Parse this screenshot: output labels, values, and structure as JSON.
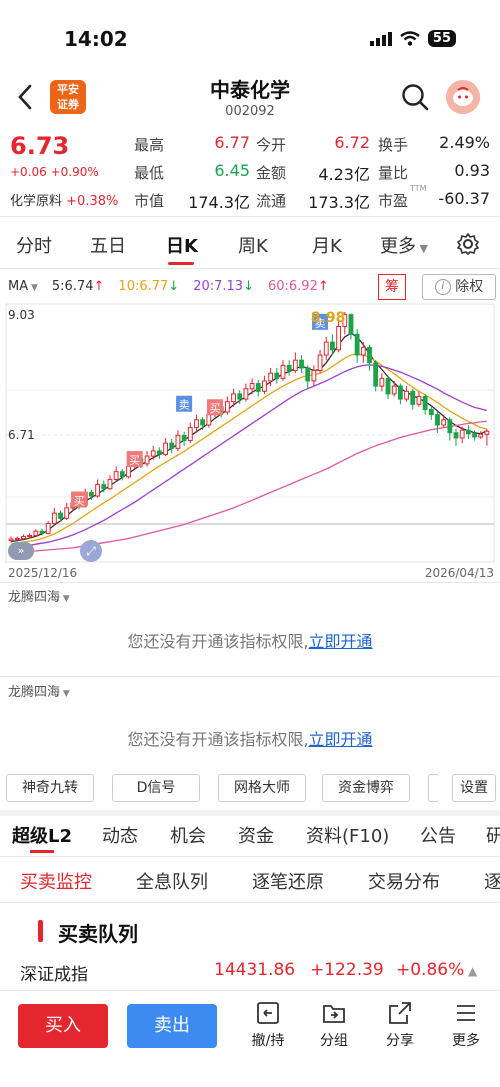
{
  "status_bar": {
    "time": "14:02",
    "battery": "55"
  },
  "header": {
    "stock_name": "中泰化学",
    "stock_code": "002092",
    "broker_logo_line1": "平安",
    "broker_logo_line2": "证券"
  },
  "quote": {
    "price": "6.73",
    "change": "+0.06 +0.90%",
    "sector": "化学原料",
    "sector_change": "+0.38%",
    "fields": [
      {
        "label": "最高",
        "value": "6.77",
        "color": "#e4262e"
      },
      {
        "label": "今开",
        "value": "6.72",
        "color": "#e4262e"
      },
      {
        "label": "换手",
        "value": "2.49%",
        "color": "#222222"
      },
      {
        "label": "最低",
        "value": "6.45",
        "color": "#1aa34a"
      },
      {
        "label": "金额",
        "value": "4.23亿",
        "color": "#222222"
      },
      {
        "label": "量比",
        "value": "0.93",
        "color": "#222222"
      },
      {
        "label": "市值",
        "value": "174.3亿",
        "color": "#222222"
      },
      {
        "label": "流通",
        "value": "173.3亿",
        "color": "#222222"
      },
      {
        "label": "市盈",
        "value": "-60.37",
        "color": "#222222",
        "sup": "TTM"
      }
    ]
  },
  "period_tabs": [
    "分时",
    "五日",
    "日K",
    "周K",
    "月K",
    "更多"
  ],
  "active_period": "日K",
  "ma_legend": {
    "label": "MA",
    "items": [
      {
        "text": "5:6.74",
        "arrow": "↑",
        "color": "#333333",
        "arrow_color": "#e4262e"
      },
      {
        "text": "10:6.77",
        "arrow": "↓",
        "color": "#e8a317",
        "arrow_color": "#1aa34a"
      },
      {
        "text": "20:7.13",
        "arrow": "↓",
        "color": "#9b3fd1",
        "arrow_color": "#1aa34a"
      },
      {
        "text": "60:6.92",
        "arrow": "↑",
        "color": "#e0579a",
        "arrow_color": "#e4262e"
      }
    ],
    "chip_label": "筹",
    "exright_label": "除权"
  },
  "chart_data": {
    "type": "candlestick",
    "y_high_label": "9.03",
    "y_mid_label": "6.71",
    "ylim": [
      4.4,
      9.03
    ],
    "max_marker": "8.98",
    "date_start": "2025/12/16",
    "date_end": "2026/04/13",
    "candles": [
      [
        4.62,
        4.65,
        4.58,
        4.7
      ],
      [
        4.64,
        4.66,
        4.6,
        4.7
      ],
      [
        4.66,
        4.7,
        4.63,
        4.74
      ],
      [
        4.7,
        4.72,
        4.66,
        4.76
      ],
      [
        4.72,
        4.8,
        4.7,
        4.84
      ],
      [
        4.8,
        4.76,
        4.72,
        4.85
      ],
      [
        4.76,
        4.95,
        4.74,
        5.0
      ],
      [
        4.95,
        5.15,
        4.92,
        5.25
      ],
      [
        5.15,
        5.05,
        5.0,
        5.2
      ],
      [
        5.05,
        5.25,
        5.02,
        5.35
      ],
      [
        5.25,
        5.35,
        5.2,
        5.45
      ],
      [
        5.35,
        5.3,
        5.22,
        5.42
      ],
      [
        5.3,
        5.55,
        5.28,
        5.62
      ],
      [
        5.55,
        5.48,
        5.4,
        5.6
      ],
      [
        5.48,
        5.7,
        5.45,
        5.8
      ],
      [
        5.7,
        5.62,
        5.55,
        5.78
      ],
      [
        5.62,
        5.8,
        5.6,
        5.88
      ],
      [
        5.8,
        5.95,
        5.75,
        6.05
      ],
      [
        5.95,
        5.85,
        5.78,
        6.0
      ],
      [
        5.85,
        6.05,
        5.82,
        6.15
      ],
      [
        6.05,
        6.2,
        6.0,
        6.3
      ],
      [
        6.2,
        6.1,
        6.02,
        6.28
      ],
      [
        6.1,
        6.25,
        6.05,
        6.35
      ],
      [
        6.25,
        6.35,
        6.18,
        6.45
      ],
      [
        6.35,
        6.28,
        6.2,
        6.42
      ],
      [
        6.28,
        6.5,
        6.25,
        6.6
      ],
      [
        6.5,
        6.4,
        6.3,
        6.58
      ],
      [
        6.4,
        6.65,
        6.35,
        6.75
      ],
      [
        6.65,
        6.55,
        6.45,
        6.72
      ],
      [
        6.55,
        6.8,
        6.5,
        6.9
      ],
      [
        6.8,
        6.95,
        6.7,
        7.05
      ],
      [
        6.95,
        6.85,
        6.75,
        7.0
      ],
      [
        6.85,
        7.05,
        6.8,
        7.15
      ],
      [
        7.05,
        7.2,
        7.0,
        7.3
      ],
      [
        7.2,
        7.1,
        7.0,
        7.28
      ],
      [
        7.1,
        7.3,
        7.05,
        7.4
      ],
      [
        7.3,
        7.45,
        7.2,
        7.55
      ],
      [
        7.45,
        7.35,
        7.25,
        7.52
      ],
      [
        7.35,
        7.55,
        7.3,
        7.65
      ],
      [
        7.55,
        7.65,
        7.45,
        7.75
      ],
      [
        7.65,
        7.5,
        7.4,
        7.72
      ],
      [
        7.5,
        7.7,
        7.45,
        7.8
      ],
      [
        7.7,
        7.85,
        7.6,
        7.95
      ],
      [
        7.85,
        7.75,
        7.65,
        7.95
      ],
      [
        7.75,
        8.0,
        7.7,
        8.1
      ],
      [
        8.0,
        7.9,
        7.8,
        8.1
      ],
      [
        7.9,
        8.1,
        7.85,
        8.25
      ],
      [
        8.1,
        7.95,
        7.85,
        8.2
      ],
      [
        7.95,
        7.7,
        7.55,
        8.0
      ],
      [
        7.7,
        7.9,
        7.6,
        8.0
      ],
      [
        7.9,
        8.2,
        7.85,
        8.3
      ],
      [
        8.2,
        8.45,
        8.1,
        8.55
      ],
      [
        8.45,
        8.3,
        8.2,
        8.6
      ],
      [
        8.3,
        8.75,
        8.25,
        8.9
      ],
      [
        8.75,
        8.98,
        8.6,
        9.03
      ],
      [
        8.98,
        8.6,
        8.5,
        9.0
      ],
      [
        8.6,
        8.2,
        8.05,
        8.7
      ],
      [
        8.2,
        8.35,
        8.05,
        8.45
      ],
      [
        8.35,
        8.05,
        7.9,
        8.4
      ],
      [
        8.05,
        7.6,
        7.5,
        8.1
      ],
      [
        7.6,
        7.75,
        7.5,
        7.85
      ],
      [
        7.75,
        7.45,
        7.35,
        7.8
      ],
      [
        7.45,
        7.6,
        7.4,
        7.7
      ],
      [
        7.6,
        7.35,
        7.25,
        7.65
      ],
      [
        7.35,
        7.5,
        7.3,
        7.6
      ],
      [
        7.5,
        7.25,
        7.15,
        7.55
      ],
      [
        7.25,
        7.4,
        7.2,
        7.5
      ],
      [
        7.4,
        7.15,
        7.05,
        7.45
      ],
      [
        7.15,
        7.05,
        6.95,
        7.2
      ],
      [
        7.05,
        6.85,
        6.7,
        7.1
      ],
      [
        6.85,
        6.95,
        6.8,
        7.05
      ],
      [
        6.95,
        6.7,
        6.55,
        7.0
      ],
      [
        6.7,
        6.6,
        6.45,
        6.78
      ],
      [
        6.6,
        6.75,
        6.5,
        6.82
      ],
      [
        6.75,
        6.68,
        6.58,
        6.85
      ],
      [
        6.68,
        6.62,
        6.55,
        6.75
      ],
      [
        6.62,
        6.67,
        6.58,
        6.73
      ],
      [
        6.67,
        6.73,
        6.45,
        6.77
      ]
    ],
    "ma_lines": [
      {
        "name": "MA5",
        "color": "#333333",
        "values": [
          4.6,
          4.62,
          4.64,
          4.67,
          4.7,
          4.75,
          4.82,
          4.92,
          5.0,
          5.1,
          5.2,
          5.28,
          5.38,
          5.45,
          5.52,
          5.6,
          5.68,
          5.76,
          5.84,
          5.92,
          6.0,
          6.08,
          6.15,
          6.22,
          6.28,
          6.34,
          6.4,
          6.48,
          6.56,
          6.64,
          6.72,
          6.8,
          6.88,
          6.98,
          7.06,
          7.14,
          7.24,
          7.32,
          7.4,
          7.48,
          7.55,
          7.6,
          7.68,
          7.76,
          7.84,
          7.88,
          7.94,
          7.98,
          7.95,
          7.9,
          7.92,
          8.05,
          8.22,
          8.4,
          8.55,
          8.62,
          8.55,
          8.4,
          8.22,
          8.05,
          7.92,
          7.78,
          7.66,
          7.55,
          7.48,
          7.42,
          7.36,
          7.3,
          7.22,
          7.12,
          7.02,
          6.92,
          6.84,
          6.78,
          6.74,
          6.7,
          6.68,
          6.74
        ]
      },
      {
        "name": "MA10",
        "color": "#e8a317",
        "values": [
          4.55,
          4.57,
          4.59,
          4.61,
          4.63,
          4.66,
          4.7,
          4.75,
          4.81,
          4.88,
          4.95,
          5.03,
          5.11,
          5.19,
          5.27,
          5.35,
          5.42,
          5.5,
          5.58,
          5.66,
          5.74,
          5.82,
          5.9,
          5.98,
          6.06,
          6.13,
          6.2,
          6.27,
          6.34,
          6.42,
          6.5,
          6.58,
          6.66,
          6.74,
          6.82,
          6.9,
          6.98,
          7.06,
          7.14,
          7.22,
          7.3,
          7.38,
          7.46,
          7.53,
          7.6,
          7.66,
          7.72,
          7.77,
          7.8,
          7.82,
          7.85,
          7.9,
          7.98,
          8.06,
          8.14,
          8.2,
          8.22,
          8.2,
          8.15,
          8.08,
          8.0,
          7.92,
          7.84,
          7.75,
          7.66,
          7.58,
          7.5,
          7.43,
          7.36,
          7.28,
          7.2,
          7.12,
          7.05,
          6.98,
          6.92,
          6.86,
          6.8,
          6.77
        ]
      },
      {
        "name": "MA20",
        "color": "#9b3fd1",
        "values": [
          4.5,
          4.51,
          4.52,
          4.53,
          4.55,
          4.57,
          4.59,
          4.62,
          4.65,
          4.69,
          4.73,
          4.78,
          4.83,
          4.89,
          4.95,
          5.01,
          5.08,
          5.15,
          5.22,
          5.29,
          5.36,
          5.44,
          5.52,
          5.6,
          5.68,
          5.76,
          5.84,
          5.92,
          6.0,
          6.08,
          6.16,
          6.24,
          6.32,
          6.4,
          6.48,
          6.56,
          6.64,
          6.72,
          6.8,
          6.88,
          6.96,
          7.04,
          7.12,
          7.2,
          7.28,
          7.36,
          7.43,
          7.5,
          7.55,
          7.6,
          7.65,
          7.7,
          7.76,
          7.82,
          7.88,
          7.93,
          7.97,
          8.0,
          8.01,
          8.0,
          7.98,
          7.95,
          7.91,
          7.87,
          7.82,
          7.77,
          7.72,
          7.66,
          7.6,
          7.54,
          7.47,
          7.41,
          7.35,
          7.29,
          7.24,
          7.19,
          7.16,
          7.13
        ]
      },
      {
        "name": "MA60",
        "color": "#e0579a",
        "values": [
          4.4,
          4.41,
          4.41,
          4.42,
          4.42,
          4.43,
          4.44,
          4.45,
          4.46,
          4.47,
          4.48,
          4.5,
          4.52,
          4.54,
          4.56,
          4.58,
          4.6,
          4.62,
          4.64,
          4.66,
          4.69,
          4.72,
          4.75,
          4.78,
          4.81,
          4.84,
          4.87,
          4.9,
          4.93,
          4.97,
          5.01,
          5.05,
          5.09,
          5.13,
          5.17,
          5.21,
          5.25,
          5.3,
          5.35,
          5.4,
          5.45,
          5.5,
          5.55,
          5.6,
          5.65,
          5.7,
          5.75,
          5.8,
          5.85,
          5.9,
          5.95,
          6.0,
          6.06,
          6.12,
          6.18,
          6.24,
          6.3,
          6.35,
          6.4,
          6.45,
          6.49,
          6.53,
          6.57,
          6.61,
          6.64,
          6.67,
          6.7,
          6.73,
          6.76,
          6.78,
          6.8,
          6.82,
          6.84,
          6.86,
          6.88,
          6.89,
          6.91,
          6.92
        ]
      }
    ],
    "signals": [
      {
        "label": "买",
        "index": 11,
        "kind": "buy"
      },
      {
        "label": "买",
        "index": 20,
        "kind": "buy"
      },
      {
        "label": "卖",
        "index": 28,
        "kind": "sell"
      },
      {
        "label": "买",
        "index": 33,
        "kind": "buy"
      },
      {
        "label": "卖",
        "index": 50,
        "kind": "sell"
      }
    ]
  },
  "indicator_panels": [
    {
      "title": "龙腾四海",
      "message": "您还没有开通该指标权限,",
      "link": "立即开通"
    },
    {
      "title": "龙腾四海",
      "message": "您还没有开通该指标权限,",
      "link": "立即开通"
    }
  ],
  "tools": [
    "神奇九转",
    "D信号",
    "网格大师",
    "资金博弈",
    "设置"
  ],
  "info_tabs": [
    "超级L2",
    "动态",
    "机会",
    "资金",
    "资料(F10)",
    "公告",
    "研"
  ],
  "sub_tabs": [
    "买卖监控",
    "全息队列",
    "逐笔还原",
    "交易分布",
    "逐"
  ],
  "queue_title": "买卖队列",
  "index_ticker": {
    "name": "深证成指",
    "value": "14431.86",
    "change": "+122.39",
    "pct": "+0.86%"
  },
  "bottom_bar": {
    "buy": "买入",
    "sell": "卖出",
    "items": [
      {
        "label": "撤/持",
        "icon": "withdraw-icon"
      },
      {
        "label": "分组",
        "icon": "folder-icon"
      },
      {
        "label": "分享",
        "icon": "share-icon"
      },
      {
        "label": "更多",
        "icon": "menu-icon"
      }
    ]
  }
}
